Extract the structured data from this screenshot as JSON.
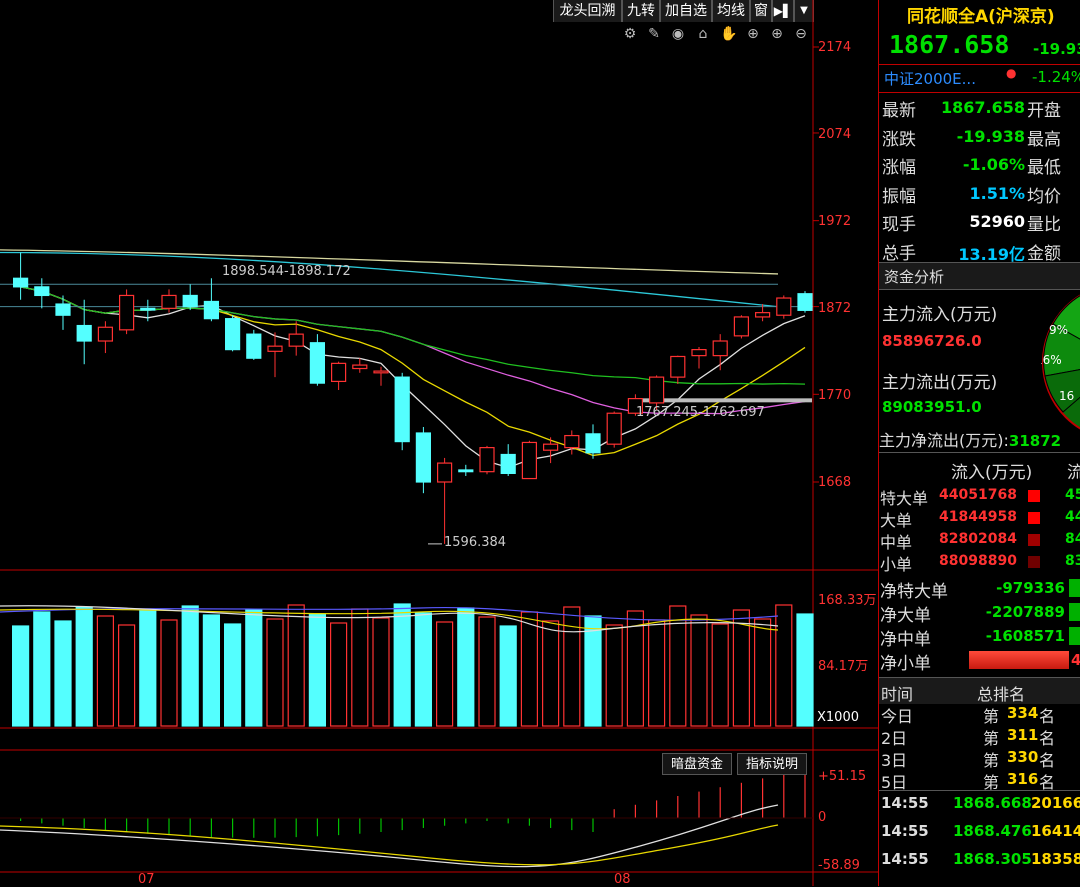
{
  "toolbar": {
    "buttons": [
      "龙头回溯",
      "九转",
      "加自选",
      "均线",
      "窗"
    ]
  },
  "icons": [
    "gear-icon",
    "brush-icon",
    "eye-icon",
    "lock-icon",
    "hand-icon",
    "add-icon",
    "zoom-in-icon",
    "zoom-out-icon"
  ],
  "price_axis": [
    "2174",
    "2074",
    "1972",
    "1872",
    "1770",
    "1668"
  ],
  "volume_axis": [
    "168.33万",
    "84.17万",
    "X1000"
  ],
  "indicator_axis": [
    "+51.15",
    "0",
    "-58.89"
  ],
  "date_axis": [
    "07",
    "08"
  ],
  "annotations": {
    "high_line": "1898.544-1898.172",
    "low_line": "1767.245-1762.697",
    "min_point": "1596.384"
  },
  "indicator_buttons": [
    "暗盘资金",
    "指标说明"
  ],
  "quote": {
    "name": "同花顺全A(沪深京)",
    "price": "1867.658",
    "change": "-19.93",
    "related_index": "中证2000E...",
    "related_change": "-1.24%",
    "rows": [
      {
        "label": "最新",
        "value": "1867.658",
        "label2": "开盘",
        "color": "#00e000"
      },
      {
        "label": "涨跌",
        "value": "-19.938",
        "label2": "最高",
        "color": "#00e000"
      },
      {
        "label": "涨幅",
        "value": "-1.06%",
        "label2": "最低",
        "color": "#00e000"
      },
      {
        "label": "振幅",
        "value": "1.51%",
        "label2": "均价",
        "color": "#00c8ff"
      },
      {
        "label": "现手",
        "value": "52960",
        "label2": "量比",
        "color": "#ffffff"
      },
      {
        "label": "总手",
        "value": "13.19亿",
        "label2": "金额",
        "color": "#00c8ff"
      }
    ]
  },
  "fund": {
    "title": "资金分析",
    "inflow_label": "主力流入(万元)",
    "inflow_value": "85896726.0",
    "outflow_label": "主力流出(万元)",
    "outflow_value": "89083951.0",
    "net_label": "主力净流出(万元):",
    "net_value": "31872",
    "pie_labels": [
      "9%",
      "16%",
      "16"
    ],
    "col_header1": "流入(万元)",
    "col_header2": "流",
    "orders": [
      {
        "label": "特大单",
        "inflow": "44051768",
        "out": "45"
      },
      {
        "label": "大单",
        "inflow": "41844958",
        "out": "44"
      },
      {
        "label": "中单",
        "inflow": "82802084",
        "out": "84"
      },
      {
        "label": "小单",
        "inflow": "88098890",
        "out": "83"
      }
    ],
    "net_orders": [
      {
        "label": "净特大单",
        "value": "-979336"
      },
      {
        "label": "净大单",
        "value": "-2207889"
      },
      {
        "label": "净中单",
        "value": "-1608571"
      },
      {
        "label": "净小单",
        "value": "4"
      }
    ]
  },
  "ranking": {
    "header_time": "时间",
    "header_rank": "总排名",
    "rows": [
      {
        "period": "今日",
        "prefix": "第",
        "rank": "334",
        "suffix": "名"
      },
      {
        "period": "2日",
        "prefix": "第",
        "rank": "311",
        "suffix": "名"
      },
      {
        "period": "3日",
        "prefix": "第",
        "rank": "330",
        "suffix": "名"
      },
      {
        "period": "5日",
        "prefix": "第",
        "rank": "316",
        "suffix": "名"
      }
    ]
  },
  "ticks": [
    {
      "time": "14:55",
      "price": "1868.668",
      "vol": "20166"
    },
    {
      "time": "14:55",
      "price": "1868.476",
      "vol": "16414"
    },
    {
      "time": "14:55",
      "price": "1868.305",
      "vol": "18358"
    }
  ],
  "chart_data": {
    "type": "candlestick",
    "price_range": [
      1596.384,
      2174
    ],
    "candles": [
      {
        "o": 1905,
        "h": 1935,
        "l": 1880,
        "c": 1895
      },
      {
        "o": 1895,
        "h": 1905,
        "l": 1870,
        "c": 1885
      },
      {
        "o": 1875,
        "h": 1885,
        "l": 1845,
        "c": 1862
      },
      {
        "o": 1850,
        "h": 1880,
        "l": 1805,
        "c": 1832
      },
      {
        "o": 1832,
        "h": 1855,
        "l": 1818,
        "c": 1848
      },
      {
        "o": 1845,
        "h": 1892,
        "l": 1840,
        "c": 1885
      },
      {
        "o": 1870,
        "h": 1880,
        "l": 1855,
        "c": 1868
      },
      {
        "o": 1870,
        "h": 1892,
        "l": 1865,
        "c": 1885
      },
      {
        "o": 1885,
        "h": 1898,
        "l": 1868,
        "c": 1872
      },
      {
        "o": 1878,
        "h": 1905,
        "l": 1855,
        "c": 1858
      },
      {
        "o": 1858,
        "h": 1862,
        "l": 1820,
        "c": 1822
      },
      {
        "o": 1840,
        "h": 1845,
        "l": 1810,
        "c": 1812
      },
      {
        "o": 1820,
        "h": 1842,
        "l": 1790,
        "c": 1826
      },
      {
        "o": 1826,
        "h": 1855,
        "l": 1815,
        "c": 1840
      },
      {
        "o": 1830,
        "h": 1840,
        "l": 1780,
        "c": 1783
      },
      {
        "o": 1785,
        "h": 1808,
        "l": 1775,
        "c": 1806
      },
      {
        "o": 1800,
        "h": 1812,
        "l": 1795,
        "c": 1804
      },
      {
        "o": 1795,
        "h": 1802,
        "l": 1780,
        "c": 1797
      },
      {
        "o": 1790,
        "h": 1795,
        "l": 1705,
        "c": 1715
      },
      {
        "o": 1725,
        "h": 1732,
        "l": 1655,
        "c": 1668
      },
      {
        "o": 1668,
        "h": 1696,
        "l": 1596,
        "c": 1690
      },
      {
        "o": 1682,
        "h": 1688,
        "l": 1675,
        "c": 1680
      },
      {
        "o": 1680,
        "h": 1710,
        "l": 1677,
        "c": 1708
      },
      {
        "o": 1700,
        "h": 1712,
        "l": 1675,
        "c": 1678
      },
      {
        "o": 1672,
        "h": 1716,
        "l": 1672,
        "c": 1714
      },
      {
        "o": 1705,
        "h": 1720,
        "l": 1690,
        "c": 1712
      },
      {
        "o": 1708,
        "h": 1728,
        "l": 1700,
        "c": 1722
      },
      {
        "o": 1724,
        "h": 1735,
        "l": 1695,
        "c": 1702
      },
      {
        "o": 1712,
        "h": 1750,
        "l": 1708,
        "c": 1748
      },
      {
        "o": 1748,
        "h": 1770,
        "l": 1745,
        "c": 1765
      },
      {
        "o": 1760,
        "h": 1792,
        "l": 1752,
        "c": 1790
      },
      {
        "o": 1790,
        "h": 1815,
        "l": 1782,
        "c": 1814
      },
      {
        "o": 1815,
        "h": 1825,
        "l": 1800,
        "c": 1822
      },
      {
        "o": 1815,
        "h": 1840,
        "l": 1798,
        "c": 1832
      },
      {
        "o": 1838,
        "h": 1862,
        "l": 1835,
        "c": 1860
      },
      {
        "o": 1860,
        "h": 1875,
        "l": 1855,
        "c": 1865
      },
      {
        "o": 1862,
        "h": 1885,
        "l": 1858,
        "c": 1882
      },
      {
        "o": 1887,
        "h": 1890,
        "l": 1865,
        "c": 1867.658
      }
    ]
  }
}
